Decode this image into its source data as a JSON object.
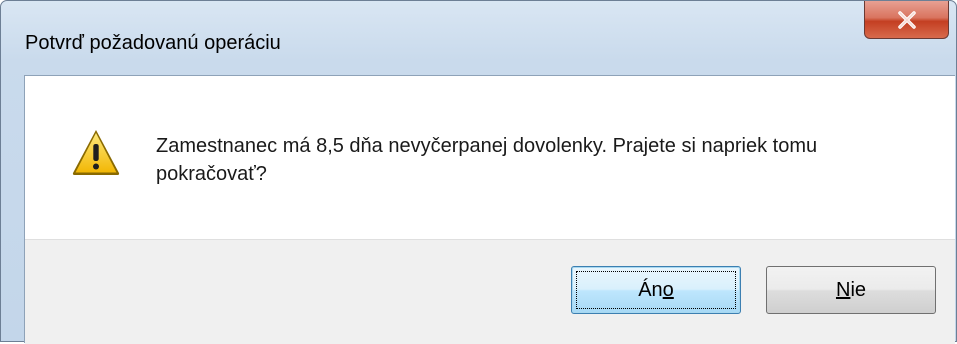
{
  "dialog": {
    "title": "Potvrď požadovanú operáciu",
    "close_icon": "close-x-icon",
    "message_icon": "warning-icon",
    "message": "Zamestnanec má 8,5 dňa nevyčerpanej dovolenky. Prajete si napriek tomu pokračovať?",
    "buttons": {
      "yes": {
        "label_pre": "Án",
        "label_mnemonic": "o",
        "label_post": ""
      },
      "no": {
        "label_pre": "",
        "label_mnemonic": "N",
        "label_post": "ie"
      }
    }
  },
  "colors": {
    "close_button": "#c43f22",
    "warning_fill": "#f7c61b",
    "default_button_border": "#3c7fb1",
    "footer_background": "#f0f0f0"
  }
}
